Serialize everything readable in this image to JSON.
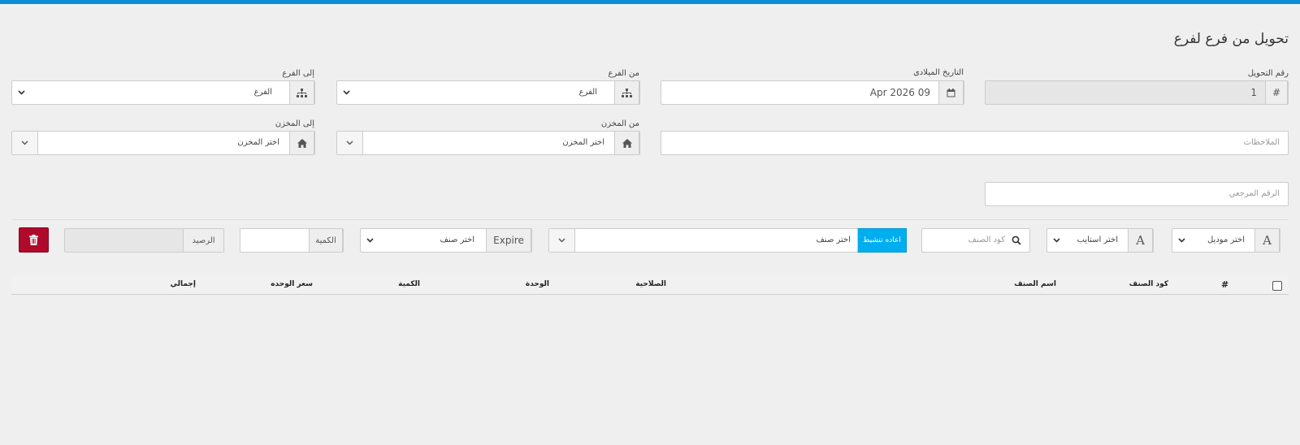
{
  "page": {
    "title": "تحويل من فرع لفرع"
  },
  "form": {
    "transfer_no": {
      "label": "رقم التحويل",
      "value": "1"
    },
    "gregorian_date": {
      "label": "التاريخ الميلادى",
      "value": "09 Apr 2026"
    },
    "from_branch": {
      "label": "من الفرع",
      "placeholder": "الفرع"
    },
    "to_branch": {
      "label": "إلى الفرع",
      "placeholder": "الفرع"
    },
    "notes": {
      "placeholder": "الملاحظات"
    },
    "from_store": {
      "label": "من المخزن",
      "placeholder": "اختر المخزن"
    },
    "to_store": {
      "label": "إلى المخزن",
      "placeholder": "اختر المخزن"
    },
    "reference_no": {
      "placeholder": "الرقم المرجعي"
    }
  },
  "item_entry": {
    "model_select": "اختر موديل",
    "style_select": "اختر استايب",
    "item_code_placeholder": "كود الصنف",
    "reset_button": "اعاده تنشيط",
    "item_select": "اختر صنف",
    "expire_label": "Expire",
    "expire_select": "اختر صنف",
    "quantity_label": "الكمية",
    "balance_label": "الرصيد"
  },
  "table": {
    "columns": [
      "#",
      "كود الصنف",
      "اسم الصنف",
      "الصلاحية",
      "الوحدة",
      "الكمية",
      "سعر الوحده",
      "إجمالي"
    ]
  },
  "colors": {
    "topbar": "#0a8fd6",
    "reset": "#00aeef",
    "delete": "#b00a2a"
  }
}
